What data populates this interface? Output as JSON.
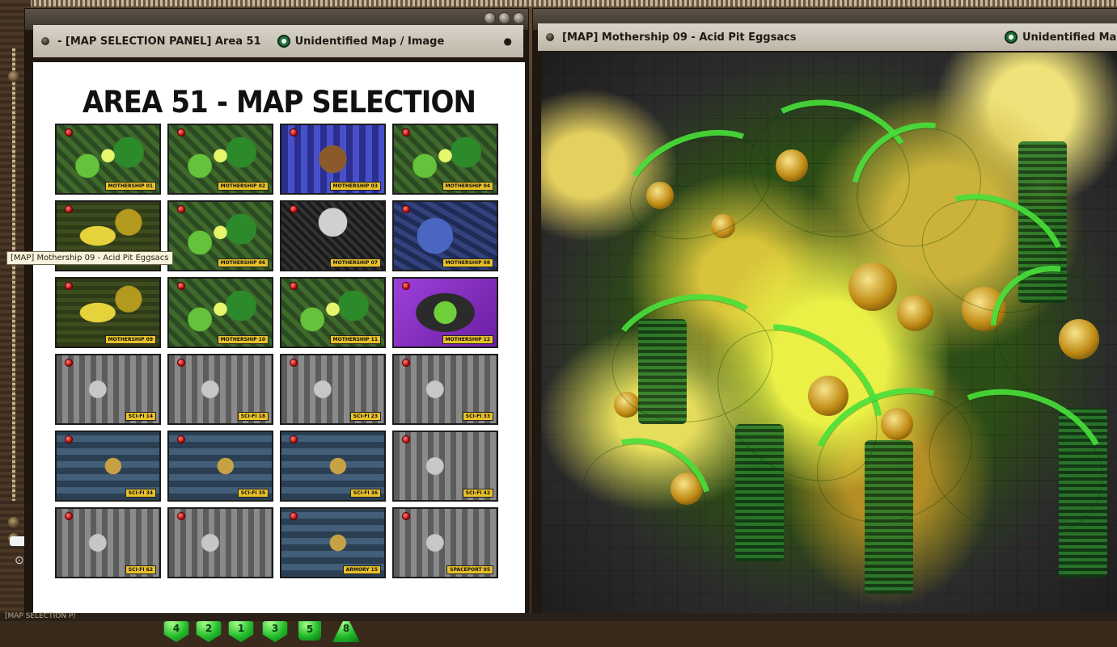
{
  "panel": {
    "window_title": "- [MAP SELECTION PANEL] Area 51",
    "id_label": "Unidentified Map / Image",
    "heading": "AREA 51 - MAP SELECTION",
    "thumbnails": [
      {
        "label": "MOTHERSHIP 01",
        "style": "green"
      },
      {
        "label": "MOTHERSHIP 02",
        "style": "green"
      },
      {
        "label": "MOTHERSHIP 03",
        "style": "blue"
      },
      {
        "label": "MOTHERSHIP 04",
        "style": "green"
      },
      {
        "label": "",
        "style": "yellow"
      },
      {
        "label": "MOTHERSHIP 06",
        "style": "green"
      },
      {
        "label": "MOTHERSHIP 07",
        "style": "night"
      },
      {
        "label": "MOTHERSHIP 08",
        "style": "navy"
      },
      {
        "label": "MOTHERSHIP 09",
        "style": "yellow"
      },
      {
        "label": "MOTHERSHIP 10",
        "style": "green"
      },
      {
        "label": "MOTHERSHIP 11",
        "style": "green"
      },
      {
        "label": "MOTHERSHIP 12",
        "style": "purple"
      },
      {
        "label": "SCI-FI 14",
        "style": "grey"
      },
      {
        "label": "SCI-FI 18",
        "style": "grey"
      },
      {
        "label": "SCI-FI 23",
        "style": "grey"
      },
      {
        "label": "SCI-FI 33",
        "style": "grey"
      },
      {
        "label": "SCI-FI 34",
        "style": "teal"
      },
      {
        "label": "SCI-FI 35",
        "style": "teal"
      },
      {
        "label": "SCI-FI 36",
        "style": "teal"
      },
      {
        "label": "SCI-FI 42",
        "style": "grey"
      },
      {
        "label": "SCI-FI 62",
        "style": "grey"
      },
      {
        "label": "",
        "style": "grey"
      },
      {
        "label": "ARMORY 15",
        "style": "teal"
      },
      {
        "label": "SPACEPORT 05",
        "style": "grey"
      }
    ],
    "dice": [
      "4",
      "2",
      "1",
      "3",
      "5",
      "8"
    ]
  },
  "map_window": {
    "title": "[MAP] Mothership 09 - Acid Pit Eggsacs",
    "id_label": "Unidentified Map"
  },
  "tooltip": "[MAP] Mothership 09 - Acid Pit Eggsacs",
  "bottom_label": "[MAP SELECTION P/"
}
